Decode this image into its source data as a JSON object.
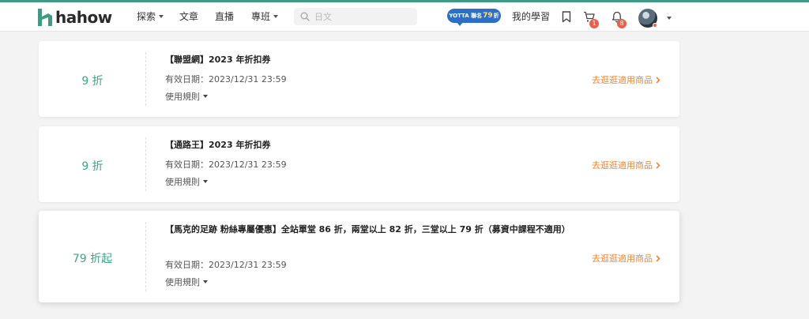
{
  "brand": {
    "name": "hahow",
    "accent": "#3f9b85"
  },
  "nav": {
    "explore": "探索",
    "articles": "文章",
    "live": "直播",
    "courses": "專班"
  },
  "search": {
    "placeholder": "日文"
  },
  "promo": {
    "prefix": "YOTTA 聯名",
    "number": "79",
    "suffix": "折"
  },
  "header": {
    "my_learning": "我的學習",
    "cart_count": "1",
    "notification_count": "8"
  },
  "coupons": [
    {
      "discount": "9 折",
      "title": "【聯盟網】2023 年折扣券",
      "expiry": "有效日期：2023/12/31 23:59",
      "rules_label": "使用規則",
      "shop_label": "去逛逛適用商品"
    },
    {
      "discount": "9 折",
      "title": "【通路王】2023 年折扣券",
      "expiry": "有效日期：2023/12/31 23:59",
      "rules_label": "使用規則",
      "shop_label": "去逛逛適用商品"
    },
    {
      "discount": "79 折起",
      "title": "【馬克的足跡 粉絲專屬優惠】全站單堂 86 折，兩堂以上 82 折，三堂以上 79 折（募資中課程不適用）",
      "expiry": "有效日期：2023/12/31 23:59",
      "rules_label": "使用規則",
      "shop_label": "去逛逛適用商品"
    }
  ],
  "colors": {
    "discount": "#3fa48a",
    "link": "#e8883a",
    "badge": "#e8604c",
    "promo_bg": "#2d6fc7"
  }
}
